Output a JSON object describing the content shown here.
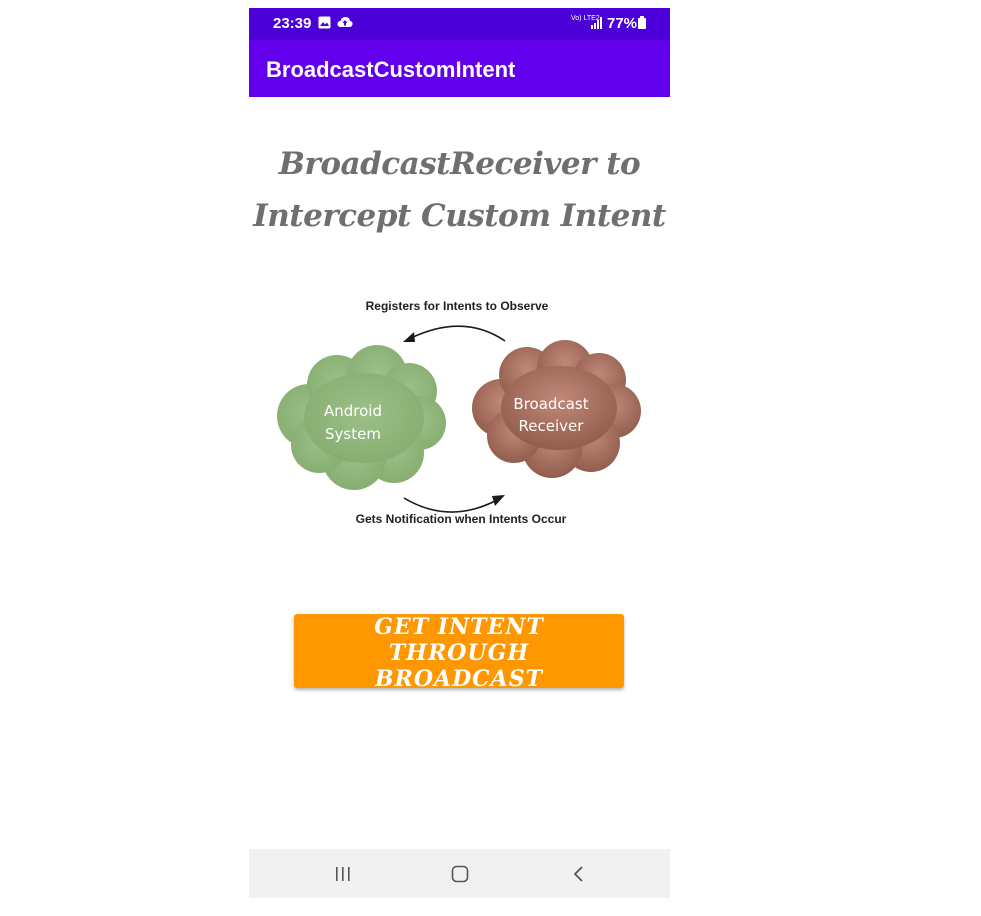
{
  "status_bar": {
    "time": "23:39",
    "network": "Vo) LTE2",
    "battery": "77%",
    "icons": [
      "image-icon",
      "cloud-upload-icon",
      "signal-icon",
      "battery-icon"
    ]
  },
  "app_bar": {
    "title": "BroadcastCustomIntent"
  },
  "headline": {
    "line1": "BroadcastReceiver to",
    "line2": "Intercept Custom Intent"
  },
  "diagram": {
    "top_label": "Registers for Intents to Observe",
    "bottom_label": "Gets Notification when Intents Occur",
    "left_cloud": {
      "line1": "Android",
      "line2": "System",
      "color": "#93b77d"
    },
    "right_cloud": {
      "line1": "Broadcast",
      "line2": "Receiver",
      "color": "#b47a6a"
    }
  },
  "button": {
    "label_line1": "GET INTENT THROUGH",
    "label_line2": "BROADCAST",
    "color": "#ff9800"
  },
  "nav_bar": {
    "icons": [
      "recents-icon",
      "home-icon",
      "back-icon"
    ]
  },
  "colors": {
    "status_bar": "#4a00d6",
    "app_bar": "#6200ee"
  }
}
